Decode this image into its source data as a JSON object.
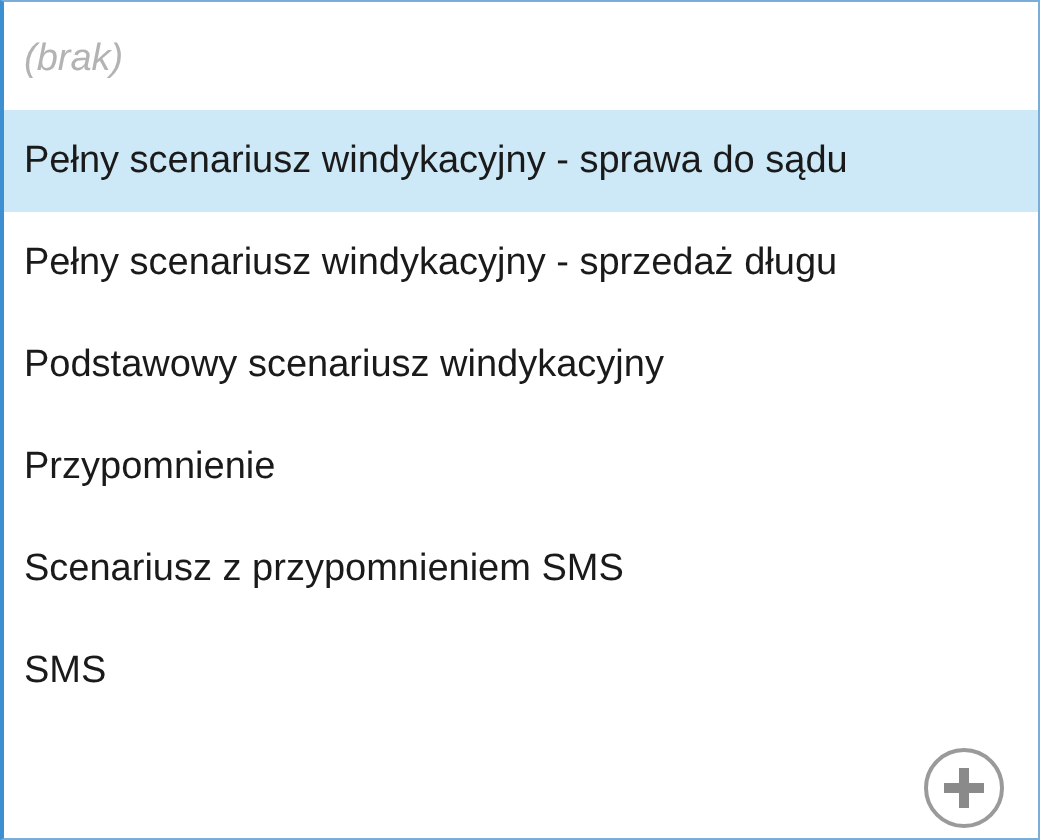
{
  "items": [
    {
      "label": "(brak)",
      "kind": "empty",
      "selected": false
    },
    {
      "label": "Pełny scenariusz windykacyjny - sprawa do sądu",
      "kind": "option",
      "selected": true
    },
    {
      "label": "Pełny scenariusz windykacyjny - sprzedaż długu",
      "kind": "option",
      "selected": false
    },
    {
      "label": "Podstawowy scenariusz windykacyjny",
      "kind": "option",
      "selected": false
    },
    {
      "label": "Przypomnienie",
      "kind": "option",
      "selected": false
    },
    {
      "label": "Scenariusz z przypomnieniem SMS",
      "kind": "option",
      "selected": false
    },
    {
      "label": "SMS",
      "kind": "option",
      "selected": false
    }
  ]
}
